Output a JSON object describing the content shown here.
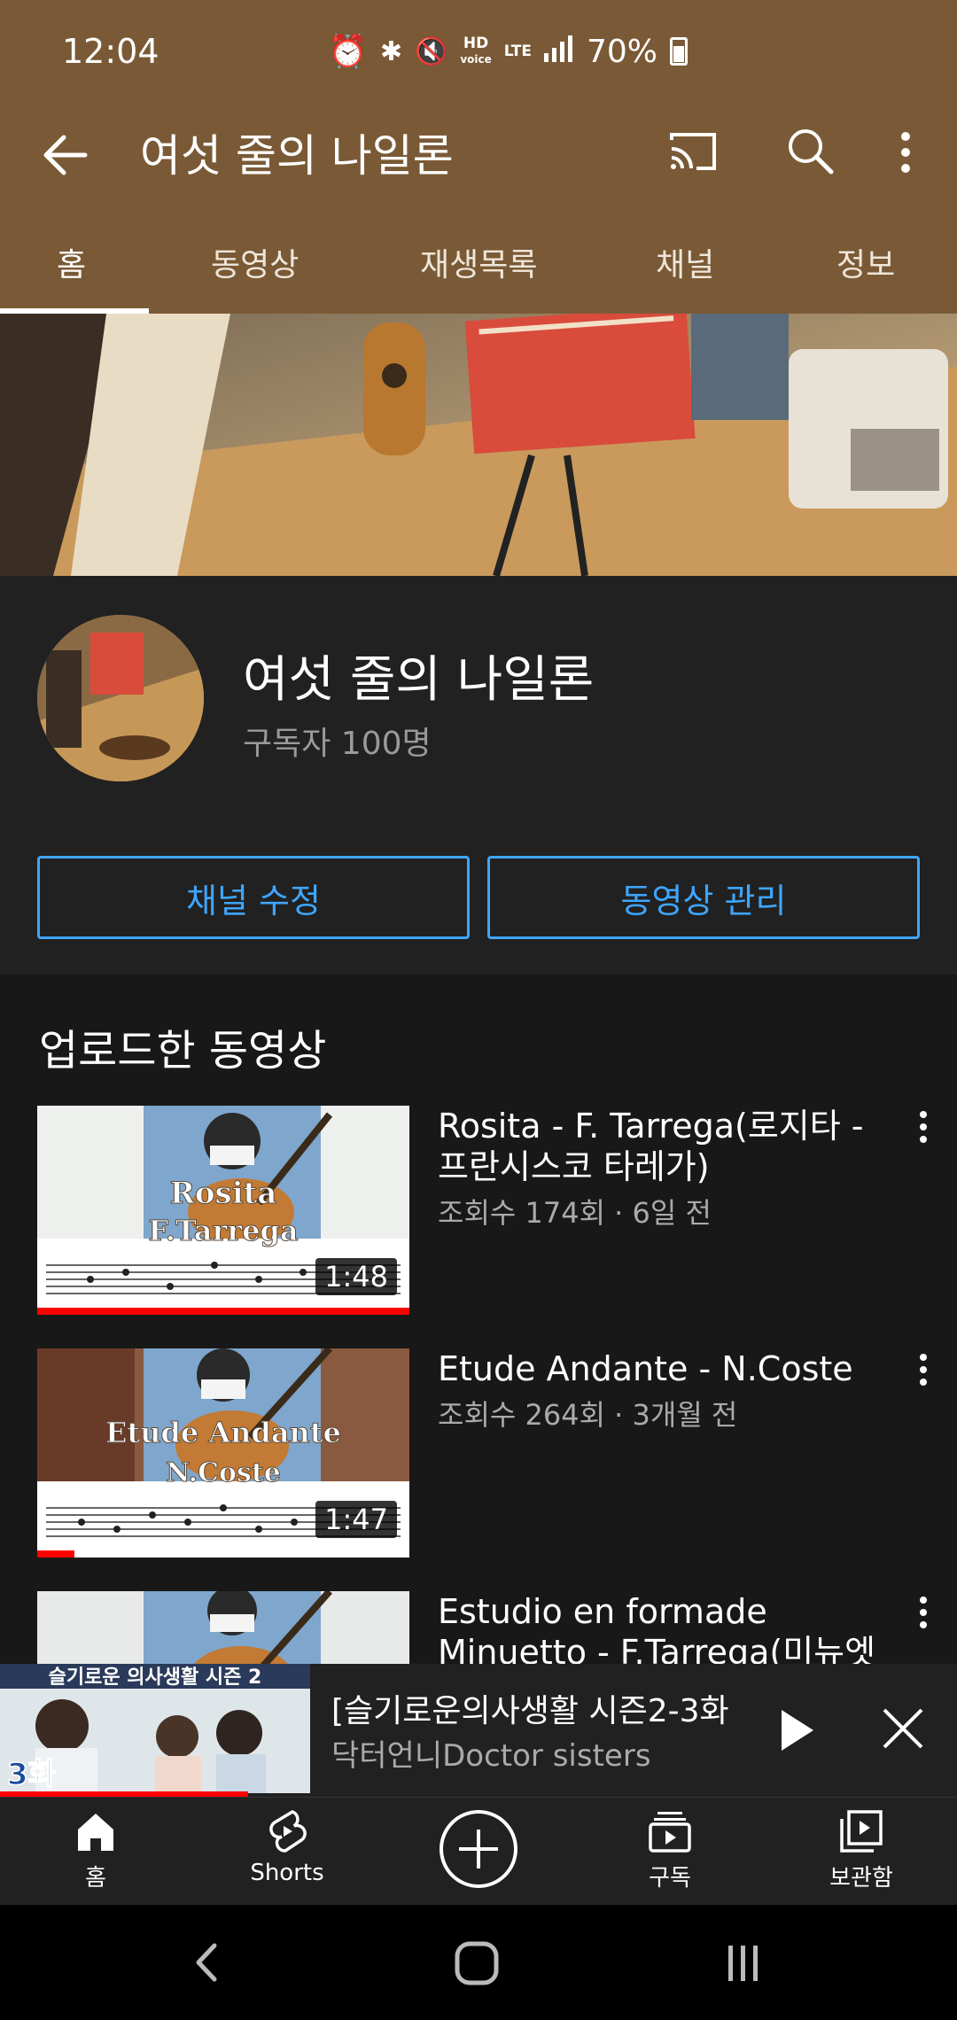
{
  "status_bar": {
    "time": "12:04",
    "hd_label": "HD",
    "voice_label": "voice",
    "lte_label": "LTE",
    "battery": "70%"
  },
  "app_bar": {
    "title": "여섯 줄의 나일론"
  },
  "tabs": [
    "홈",
    "동영상",
    "재생목록",
    "채널",
    "정보"
  ],
  "channel": {
    "name": "여섯 줄의 나일론",
    "subscribers": "구독자 100명",
    "edit_button": "채널 수정",
    "manage_button": "동영상 관리"
  },
  "section": {
    "title": "업로드한 동영상"
  },
  "videos": [
    {
      "title": "Rosita - F. Tarrega(로지타 - 프란시스코 타레가)",
      "meta": "조회수 174회 · 6일 전",
      "duration": "1:48",
      "thumb_title": "Rosita",
      "thumb_subtitle": "F.Tarrega",
      "watched_fraction": 1.0
    },
    {
      "title": "Etude Andante - N.Coste",
      "meta": "조회수 264회 · 3개월 전",
      "duration": "1:47",
      "thumb_title": "Etude Andante",
      "thumb_subtitle": "N.Coste",
      "watched_fraction": 0.1
    },
    {
      "title": "Estudio en formade Minuetto - F.Tarrega(미뉴엣",
      "meta": "",
      "duration": "",
      "thumb_title": "",
      "thumb_subtitle": "",
      "watched_fraction": 0
    }
  ],
  "miniplayer": {
    "title": "[슬기로운의사생활 시즌2-3화..",
    "channel": "닥터언니Doctor sisters",
    "thumb_caption": "슬기로운 의사생활 시즌 2",
    "thumb_episode": "3화",
    "progress_fraction": 0.8
  },
  "bottom_nav": {
    "home": "홈",
    "shorts": "Shorts",
    "subscriptions": "구독",
    "library": "보관함"
  },
  "colors": {
    "header_brown": "#7a5a36",
    "accent_blue": "#3ea6ff",
    "progress_red": "#ff0000",
    "background": "#181818"
  }
}
